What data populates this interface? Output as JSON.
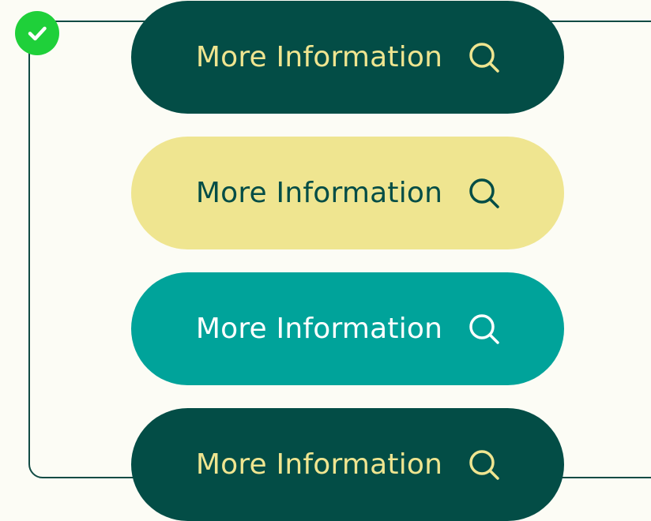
{
  "buttons": [
    {
      "label": "More Information",
      "icon": "search-icon",
      "bg": "#034d46",
      "fg": "#efe590",
      "variant": "dark-green"
    },
    {
      "label": "More Information",
      "icon": "search-icon",
      "bg": "#efe590",
      "fg": "#034d46",
      "variant": "yellow"
    },
    {
      "label": "More Information",
      "icon": "search-icon",
      "bg": "#00a39a",
      "fg": "#ffffff",
      "variant": "teal"
    },
    {
      "label": "More Information",
      "icon": "search-icon",
      "bg": "#034d46",
      "fg": "#efe590",
      "variant": "dark-green"
    }
  ],
  "status": {
    "icon": "checkmark-icon",
    "color": "#1fd03a"
  },
  "frame": {
    "border_color": "#114b44"
  }
}
